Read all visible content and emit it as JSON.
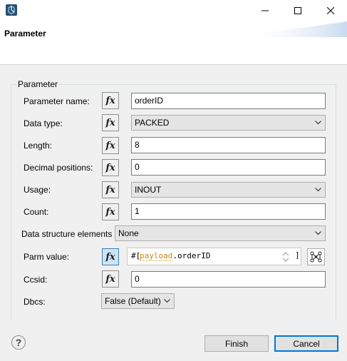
{
  "window": {
    "minimize_icon": "minimize-icon",
    "maximize_icon": "maximize-icon",
    "close_icon": "close-icon"
  },
  "header": {
    "title": "Parameter"
  },
  "group": {
    "title": "Parameter"
  },
  "fields": {
    "parameter_name": {
      "label": "Parameter name:",
      "value": "orderID"
    },
    "data_type": {
      "label": "Data type:",
      "value": "PACKED"
    },
    "length": {
      "label": "Length:",
      "value": "8"
    },
    "decimal_positions": {
      "label": "Decimal positions:",
      "value": "0"
    },
    "usage": {
      "label": "Usage:",
      "value": "INOUT"
    },
    "count": {
      "label": "Count:",
      "value": "1"
    },
    "ds_elements": {
      "label": "Data structure elements",
      "value": "None"
    },
    "parm_value": {
      "label": "Parm value:",
      "open": "#[",
      "expr_payload": "payload",
      "expr_rest": ".orderID",
      "close": "]"
    },
    "ccsid": {
      "label": "Ccsid:",
      "value": "0"
    },
    "dbcs": {
      "label": "Dbcs:",
      "value": "False (Default)"
    }
  },
  "fx_label": "fx",
  "footer": {
    "help": "?",
    "finish": "Finish",
    "cancel": "Cancel"
  },
  "colors": {
    "accent": "#0078d7",
    "expression_placeholder": "#c28a12",
    "active_fx": "#cde4f7"
  }
}
